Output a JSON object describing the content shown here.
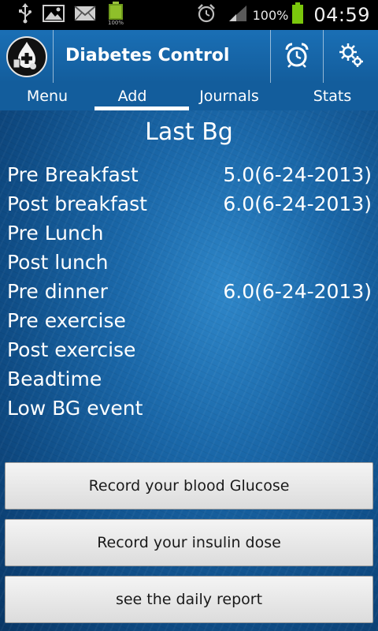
{
  "status_bar": {
    "battery_percent": "100%",
    "time": "04:59",
    "icons": [
      "usb-icon",
      "image-icon",
      "mail-icon",
      "battery-app-icon",
      "alarm-icon",
      "signal-icon",
      "battery-icon"
    ]
  },
  "app_bar": {
    "title": "Diabetes Control",
    "logo_icon": "blood-drop-logo-icon",
    "alarm_button_icon": "alarm-clock-icon",
    "settings_button_icon": "gears-icon"
  },
  "tabs": [
    {
      "label": "Menu",
      "selected": false
    },
    {
      "label": "Add",
      "selected": true
    },
    {
      "label": "Journals",
      "selected": false
    },
    {
      "label": "Stats",
      "selected": false
    }
  ],
  "main": {
    "title": "Last Bg",
    "readings": [
      {
        "label": "Pre Breakfast",
        "value": "5.0(6-24-2013)"
      },
      {
        "label": "Post breakfast",
        "value": "6.0(6-24-2013)"
      },
      {
        "label": "Pre Lunch",
        "value": ""
      },
      {
        "label": "Post lunch",
        "value": ""
      },
      {
        "label": "Pre dinner",
        "value": "6.0(6-24-2013)"
      },
      {
        "label": "Pre exercise",
        "value": ""
      },
      {
        "label": "Post exercise",
        "value": ""
      },
      {
        "label": "Beadtime",
        "value": ""
      },
      {
        "label": "Low BG event",
        "value": ""
      }
    ],
    "buttons": {
      "record_glucose": "Record your blood Glucose",
      "record_insulin": "Record your insulin dose",
      "daily_report": "see the daily report"
    }
  },
  "colors": {
    "action_bar": "#1a6fb5",
    "content_background": "#1a67a8",
    "tab_indicator": "#ffffff",
    "battery_green": "#7ac70c"
  }
}
